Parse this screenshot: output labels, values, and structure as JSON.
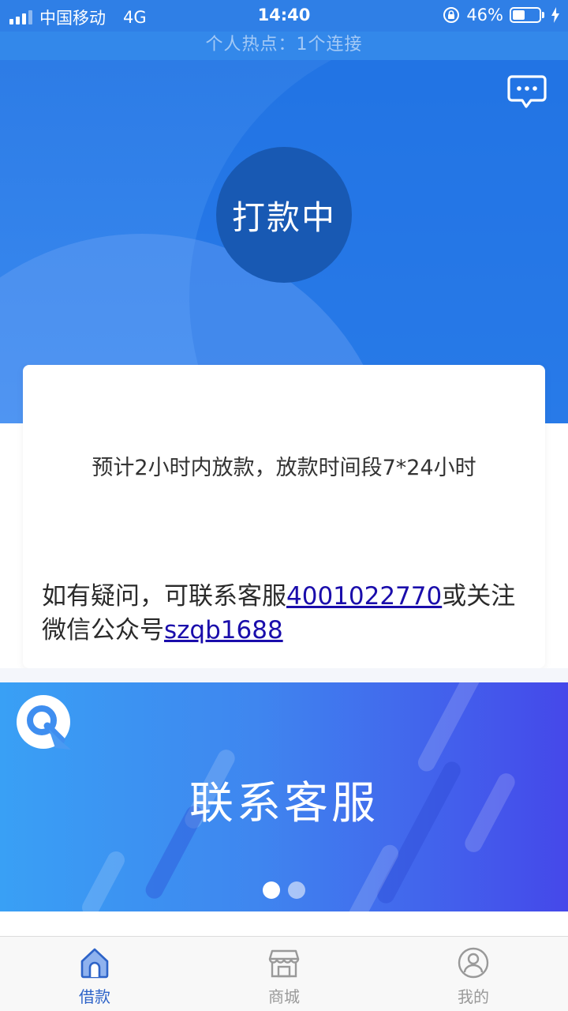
{
  "status_bar": {
    "carrier": "中国移动",
    "network": "4G",
    "time": "14:40",
    "battery": "46%",
    "battery_level": 0.46
  },
  "hotspot_banner": "个人热点：1个连接",
  "header": {
    "status_text": "打款中",
    "chat_icon": "chat-bubble-icon"
  },
  "card": {
    "eta_text": "预计2小时内放款，放款时间段7*24小时",
    "contact_prefix": "如有疑问，可联系客服",
    "phone": "4001022770",
    "contact_middle": "或关注微信公众号",
    "wechat": "szqb1688"
  },
  "banner": {
    "title": "联系客服",
    "slide_count": 2,
    "active_slide": 0
  },
  "tabs": [
    {
      "label": "借款",
      "icon": "home-icon",
      "active": true
    },
    {
      "label": "商城",
      "icon": "shop-icon",
      "active": false
    },
    {
      "label": "我的",
      "icon": "user-icon",
      "active": false
    }
  ],
  "colors": {
    "primary_blue": "#2d7ce6",
    "status_circle": "#1859b3",
    "link": "#1a0dab",
    "active_tab": "#2d63c8"
  }
}
